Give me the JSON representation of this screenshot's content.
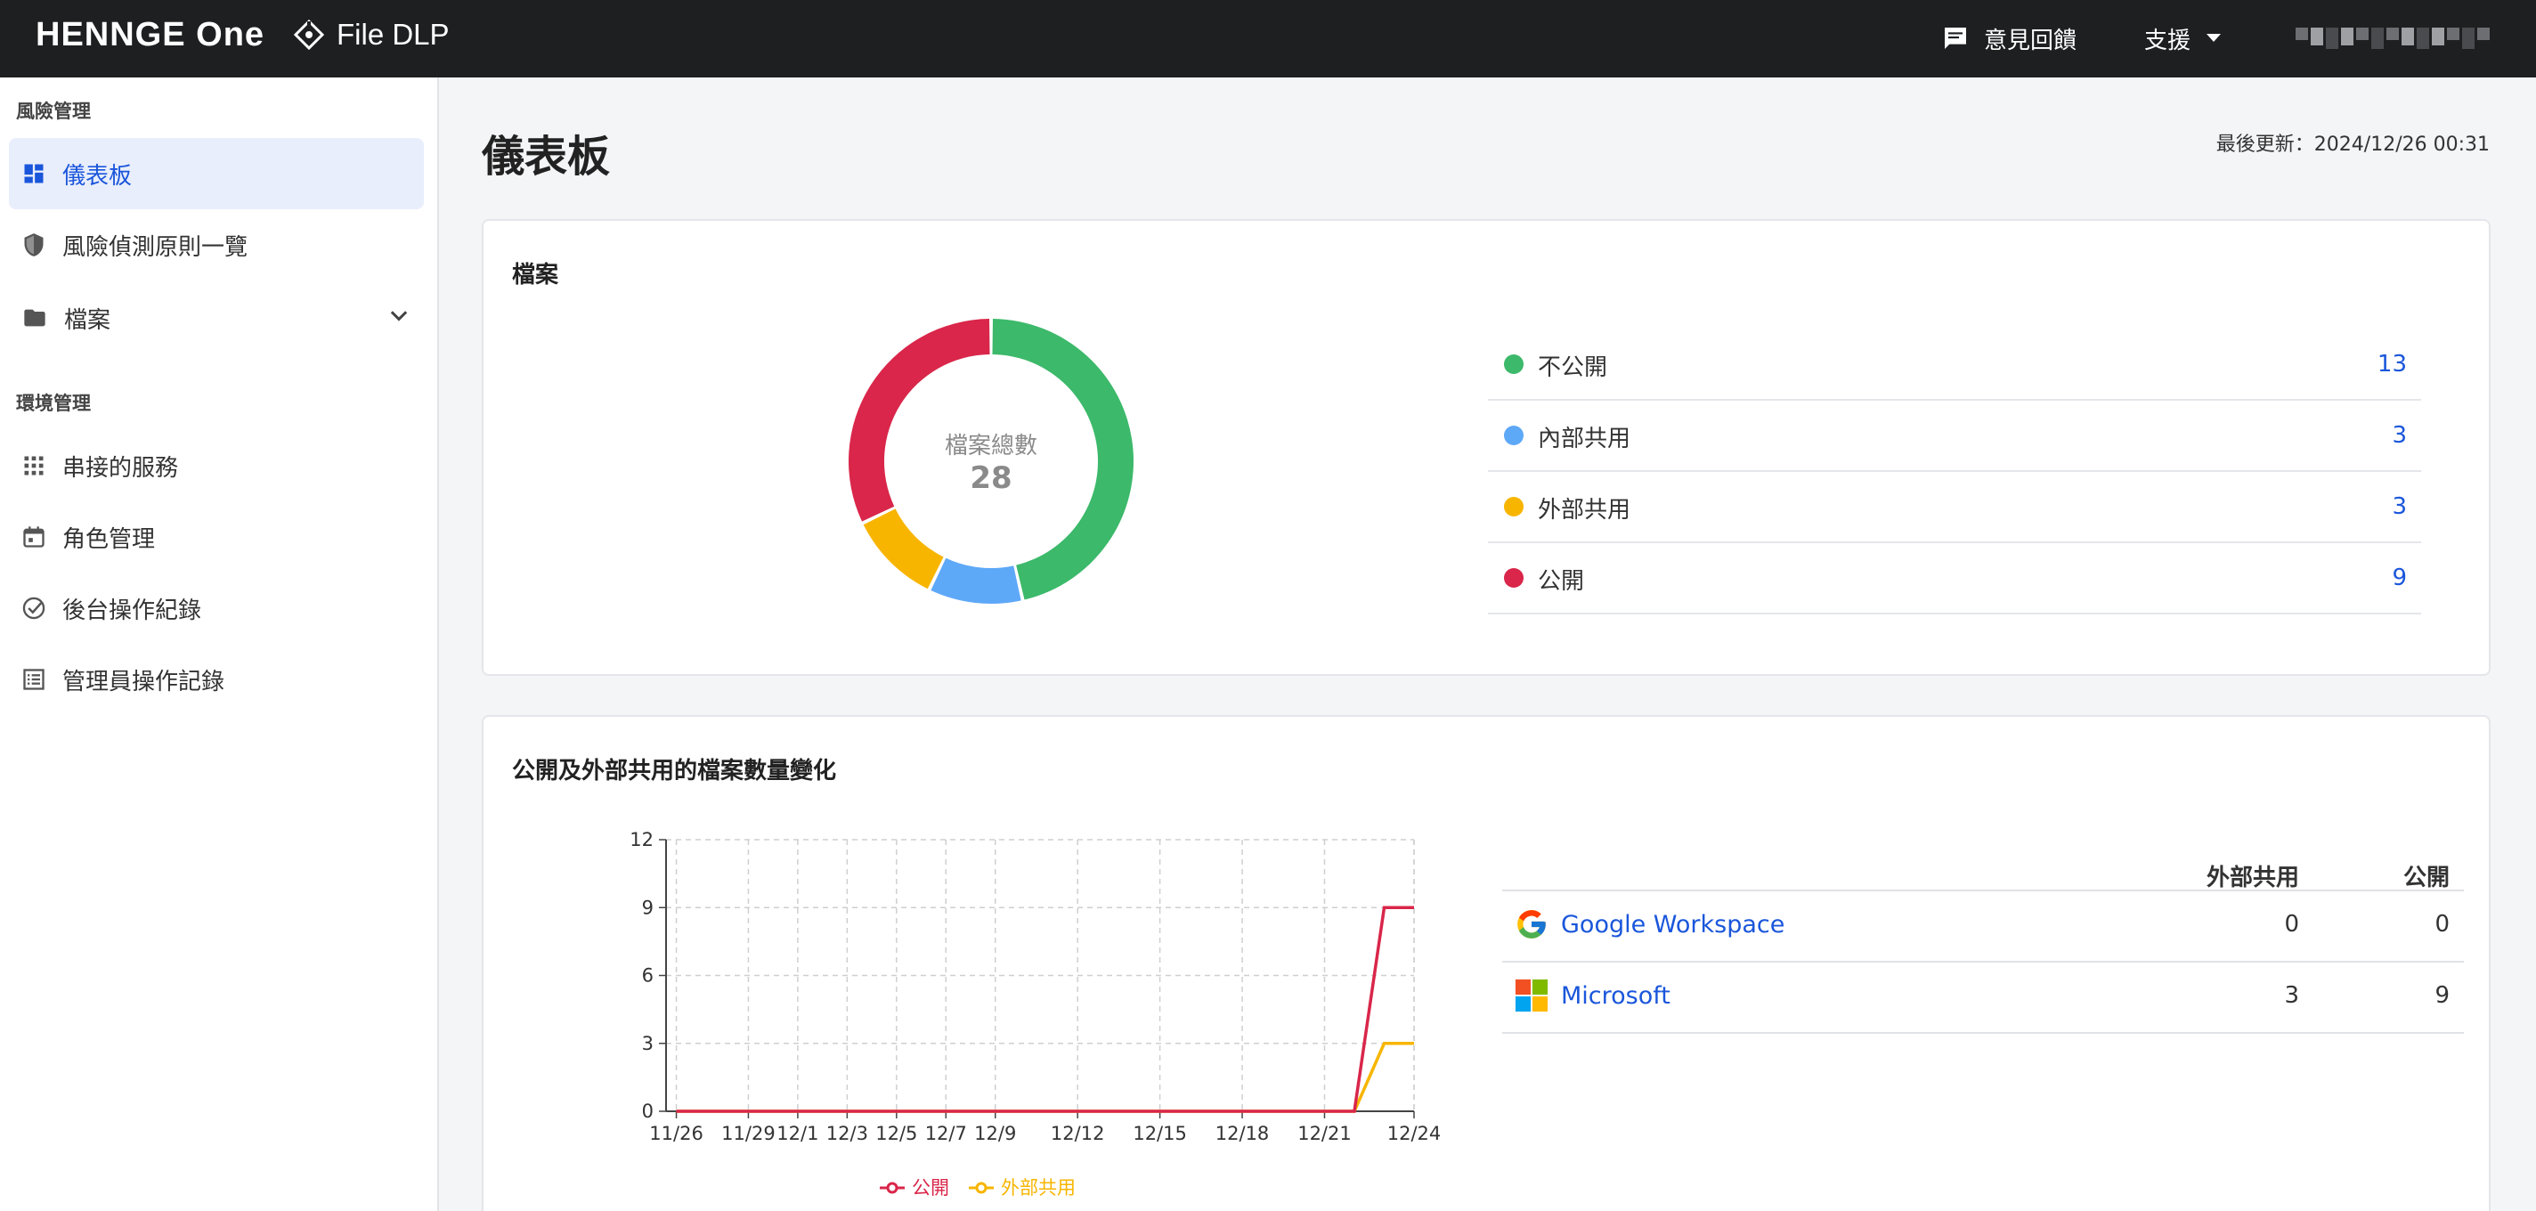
{
  "topbar": {
    "brand": "HENNGE One",
    "product": "File DLP",
    "feedback_label": "意見回饋",
    "support_label": "支援"
  },
  "sidebar": {
    "section_risk": "風險管理",
    "section_env": "環境管理",
    "items": [
      {
        "label": "儀表板",
        "icon": "dashboard-icon",
        "active": true
      },
      {
        "label": "風險偵測原則一覽",
        "icon": "shield-icon"
      },
      {
        "label": "檔案",
        "icon": "folder-icon"
      },
      {
        "label": "串接的服務",
        "icon": "grid-icon"
      },
      {
        "label": "角色管理",
        "icon": "calendar-icon"
      },
      {
        "label": "後台操作紀錄",
        "icon": "check-circle-icon"
      },
      {
        "label": "管理員操作記錄",
        "icon": "list-icon"
      }
    ]
  },
  "page": {
    "title": "儀表板",
    "last_updated": "最後更新：2024/12/26 00:31"
  },
  "files_card": {
    "title": "檔案",
    "center_label": "檔案總數",
    "total": "28",
    "categories": [
      {
        "name": "不公開",
        "count": "13",
        "color": "#3cb96a"
      },
      {
        "name": "內部共用",
        "count": "3",
        "color": "#5ea8f8"
      },
      {
        "name": "外部共用",
        "count": "3",
        "color": "#f7b500"
      },
      {
        "name": "公開",
        "count": "9",
        "color": "#d9264a"
      }
    ]
  },
  "trend_card": {
    "title": "公開及外部共用的檔案數量變化",
    "table_headers": [
      "外部共用",
      "公開"
    ],
    "providers": [
      {
        "name": "Google Workspace",
        "icon": "google-icon",
        "external": "0",
        "public": "0"
      },
      {
        "name": "Microsoft",
        "icon": "microsoft-icon",
        "external": "3",
        "public": "9"
      }
    ]
  },
  "chart_data": {
    "type": "line",
    "x": [
      "11/26",
      "11/29",
      "12/1",
      "12/3",
      "12/5",
      "12/7",
      "12/9",
      "12/12",
      "12/15",
      "12/18",
      "12/21",
      "12/22",
      "12/23",
      "12/24"
    ],
    "x_tick_labels": [
      "11/26",
      "11/29",
      "12/1",
      "12/3",
      "12/5",
      "12/7",
      "12/9",
      "12/12",
      "12/15",
      "12/18",
      "12/21",
      "12/24"
    ],
    "series": [
      {
        "name": "公開",
        "color": "#d9264a",
        "values": [
          0,
          0,
          0,
          0,
          0,
          0,
          0,
          0,
          0,
          0,
          0,
          0,
          9,
          9
        ]
      },
      {
        "name": "外部共用",
        "color": "#f7b500",
        "values": [
          0,
          0,
          0,
          0,
          0,
          0,
          0,
          0,
          0,
          0,
          0,
          0,
          3,
          3
        ]
      }
    ],
    "y_ticks": [
      0,
      3,
      6,
      9,
      12
    ],
    "ylim": [
      0,
      12
    ],
    "grid": true,
    "legend_position": "bottom"
  }
}
